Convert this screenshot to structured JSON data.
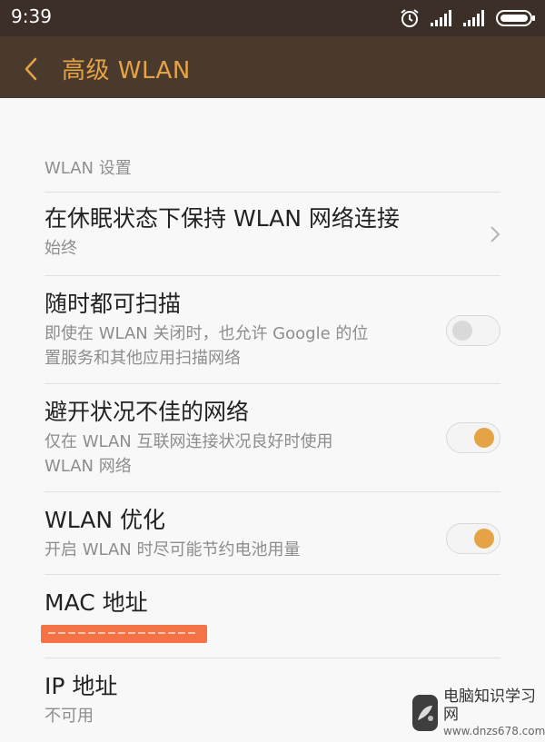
{
  "status_bar": {
    "time": "9:39",
    "icons": [
      "alarm-icon",
      "signal-icon",
      "signal-icon",
      "battery-icon"
    ]
  },
  "app_bar": {
    "back_icon": "back-chevron-icon",
    "title": "高级 WLAN",
    "accent_color": "#e6a346",
    "background_color": "#4a3a2d"
  },
  "settings": {
    "section_header": "WLAN 设置",
    "keep_wlan": {
      "title": "在休眠状态下保持 WLAN 网络连接",
      "subtitle": "始终"
    },
    "scan_always": {
      "title": "随时都可扫描",
      "subtitle_line1": "即使在 WLAN 关闭时，也允许 Google 的位",
      "subtitle_line2": "置服务和其他应用扫描网络",
      "toggle_on": false
    },
    "avoid_poor": {
      "title": "避开状况不佳的网络",
      "subtitle_line1": "仅在 WLAN 互联网连接状况良好时使用",
      "subtitle_line2": "WLAN 网络",
      "toggle_on": true
    },
    "wlan_optimize": {
      "title": "WLAN 优化",
      "subtitle": "开启 WLAN 时尽可能节约电池用量",
      "toggle_on": true
    },
    "mac_address": {
      "title": "MAC 地址"
    },
    "ip_address": {
      "title": "IP 地址",
      "subtitle": "不可用"
    }
  },
  "watermark": {
    "main_text": "电脑知识学习网",
    "sub_text": "www.dnzs678.com"
  }
}
